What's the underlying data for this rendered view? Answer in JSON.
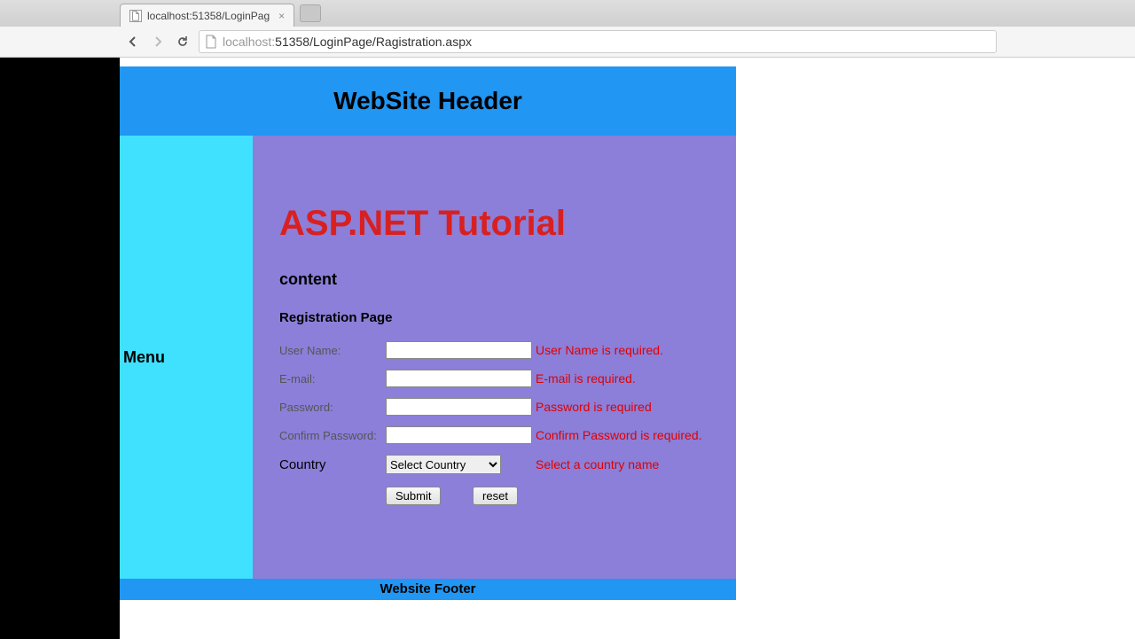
{
  "browser": {
    "tab_title": "localhost:51358/LoginPag",
    "url_host": "localhost:",
    "url_port_path": "51358/LoginPage/Ragistration.aspx"
  },
  "site": {
    "header": "WebSite Header",
    "menu": "Menu",
    "tutorial_title": "ASP.NET Tutorial",
    "content_label": "content",
    "footer": "Website Footer"
  },
  "form": {
    "title": "Registration Page",
    "fields": {
      "username": {
        "label": "User Name:",
        "error": "User Name is required."
      },
      "email": {
        "label": "E-mail:",
        "error": "E-mail is required."
      },
      "password": {
        "label": "Password:",
        "error": "Password is required"
      },
      "confirm": {
        "label": "Confirm Password:",
        "error": "Confirm Password is required."
      },
      "country": {
        "label": "Country",
        "selected": "Select Country",
        "error": "Select a country name"
      }
    },
    "buttons": {
      "submit": "Submit",
      "reset": "reset"
    }
  }
}
